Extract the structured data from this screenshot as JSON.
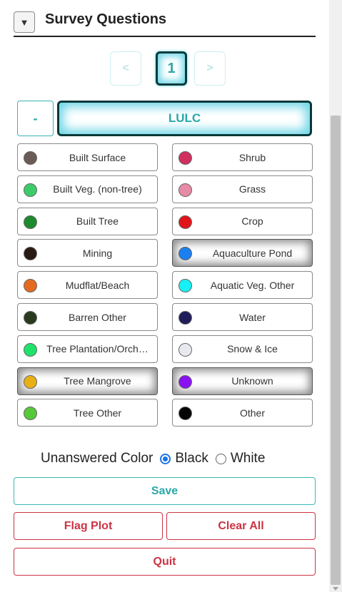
{
  "header": {
    "toggle_icon": "▼",
    "title": "Survey Questions"
  },
  "pager": {
    "prev": "<",
    "current": "1",
    "next": ">"
  },
  "question_group": {
    "collapse_label": "-",
    "name": "LULC"
  },
  "answers": [
    {
      "label": "Built Surface",
      "color": "#6b5b57",
      "selected": false
    },
    {
      "label": "Shrub",
      "color": "#d0305d",
      "selected": false
    },
    {
      "label": "Built Veg. (non-tree)",
      "color": "#3ccc6b",
      "selected": false
    },
    {
      "label": "Grass",
      "color": "#e78aa6",
      "selected": false
    },
    {
      "label": "Built Tree",
      "color": "#1e8a2e",
      "selected": false
    },
    {
      "label": "Crop",
      "color": "#e0151a",
      "selected": false
    },
    {
      "label": "Mining",
      "color": "#2a1a14",
      "selected": false
    },
    {
      "label": "Aquaculture Pond",
      "color": "#1c7ff0",
      "selected": true
    },
    {
      "label": "Mudflat/Beach",
      "color": "#e46a20",
      "selected": false
    },
    {
      "label": "Aquatic Veg. Other",
      "color": "#17f0f4",
      "selected": false
    },
    {
      "label": "Barren Other",
      "color": "#2a3a1e",
      "selected": false
    },
    {
      "label": "Water",
      "color": "#1f1e5a",
      "selected": false
    },
    {
      "label": "Tree Plantation/Orch…",
      "color": "#1ee36a",
      "selected": false
    },
    {
      "label": "Snow & Ice",
      "color": "#e8e8ef",
      "selected": false
    },
    {
      "label": "Tree Mangrove",
      "color": "#e8b014",
      "selected": true
    },
    {
      "label": "Unknown",
      "color": "#8a12f0",
      "selected": true
    },
    {
      "label": "Tree Other",
      "color": "#56c83a",
      "selected": false
    },
    {
      "label": "Other",
      "color": "#050505",
      "selected": false
    }
  ],
  "unanswered_color": {
    "label": "Unanswered Color",
    "options": [
      "Black",
      "White"
    ],
    "selected": "Black"
  },
  "actions": {
    "save": "Save",
    "flag_plot": "Flag Plot",
    "clear_all": "Clear All",
    "quit": "Quit"
  }
}
